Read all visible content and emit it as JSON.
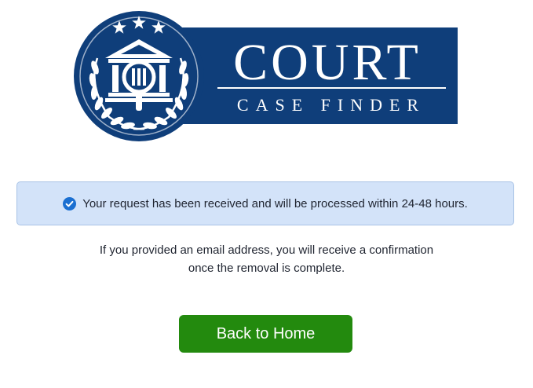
{
  "logo": {
    "title": "COURT",
    "subtitle": "CASE FINDER",
    "brand_color": "#0f3e7a",
    "emblem_icon": "courthouse-magnifier-icon",
    "stars_icon": "star-icon"
  },
  "alert": {
    "icon": "check-circle-icon",
    "message": "Your request has been received and will be processed within 24-48 hours."
  },
  "info": {
    "line1": "If you provided an email address, you will receive a confirmation",
    "line2": "once the removal is complete."
  },
  "actions": {
    "home_label": "Back to Home",
    "home_color": "#238a0e"
  }
}
